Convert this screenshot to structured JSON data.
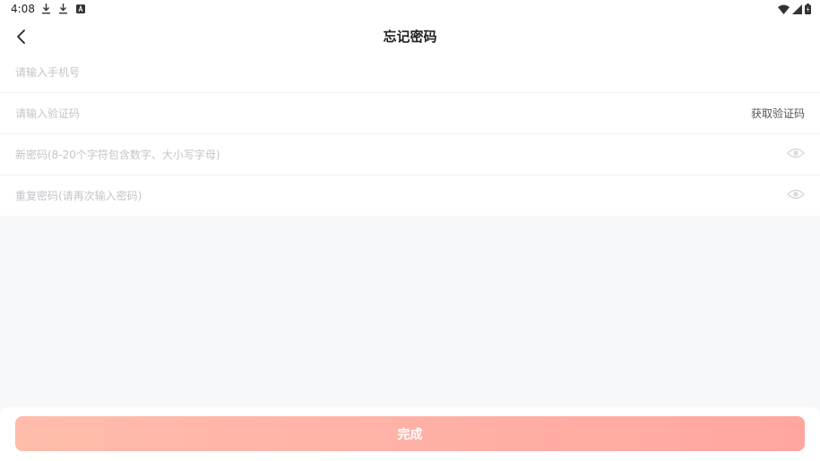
{
  "status_bar": {
    "time": "4:08",
    "icons": [
      "download-icon",
      "download-icon",
      "app-notification-icon"
    ],
    "right_icons": [
      "wifi-icon",
      "signal-icon",
      "battery-icon"
    ]
  },
  "header": {
    "back_icon": "back-arrow-icon",
    "title": "忘记密码"
  },
  "form": {
    "phone_placeholder": "请输入手机号",
    "code_placeholder": "请输入验证码",
    "get_code_label": "获取验证码",
    "new_password_placeholder": "新密码(8-20个字符包含数字、大小写字母)",
    "repeat_password_placeholder": "重复密码(请再次输入密码)",
    "eye_icon": "eye-icon"
  },
  "submit": {
    "label": "完成"
  },
  "colors": {
    "button_gradient_start": "#ffbcab",
    "button_gradient_end": "#ffa6a0",
    "background": "#f7f8fa"
  }
}
